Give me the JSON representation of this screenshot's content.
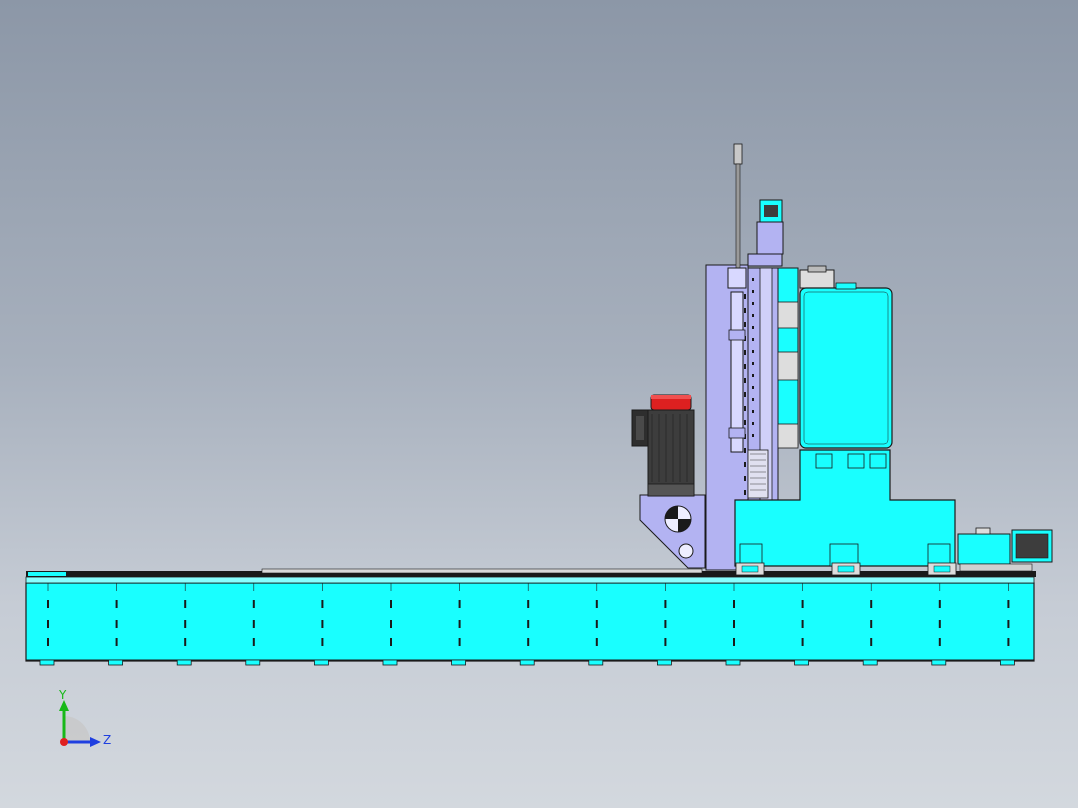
{
  "view": {
    "kind": "cad-3d-viewport",
    "background_top": "#8c97a7",
    "background_bottom": "#d3d8de"
  },
  "colors": {
    "cyan": "#19ffff",
    "lavender": "#b3b3f2",
    "motor_dark": "#3d3d3d",
    "motor_red": "#dd2020",
    "edge": "#1a1a1a",
    "axis_y": "#18b818",
    "axis_z": "#1f3fe0",
    "axis_origin": "#e02020"
  },
  "model": {
    "parts": [
      {
        "name": "machine-bed",
        "color": "cyan"
      },
      {
        "name": "column",
        "color": "lavender"
      },
      {
        "name": "spindle-head",
        "color": "cyan"
      },
      {
        "name": "saddle",
        "color": "cyan"
      },
      {
        "name": "main-motor",
        "color": "motor_dark"
      },
      {
        "name": "servo-motor",
        "color": "cyan"
      },
      {
        "name": "top-servo-motor",
        "color": "cyan"
      },
      {
        "name": "air-cylinder",
        "color": "lavender"
      }
    ]
  },
  "triad": {
    "y_label": "Y",
    "z_label": "Z",
    "icon": "coordinate-triad-icon"
  }
}
